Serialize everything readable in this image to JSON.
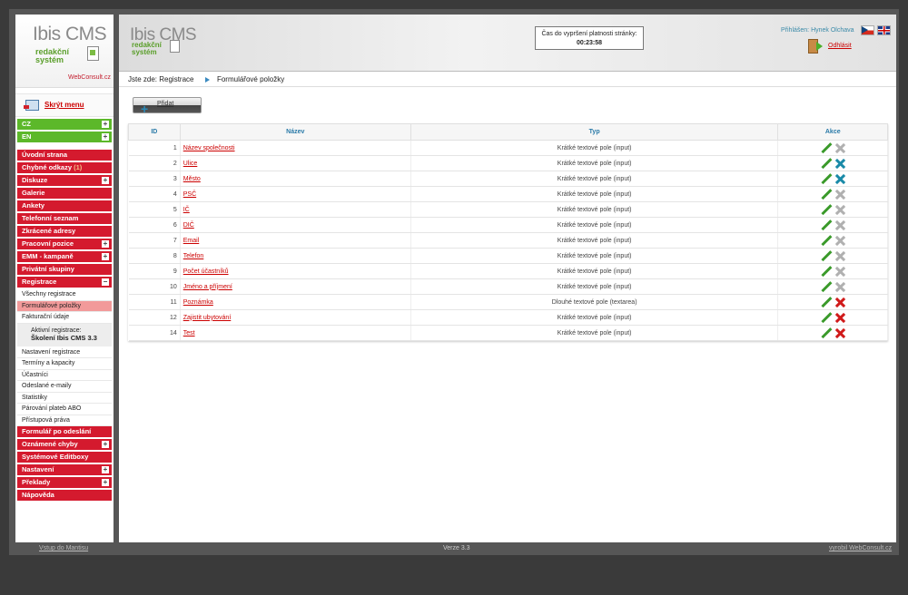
{
  "logo": {
    "title": "Ibis CMS",
    "sub1": "redakční",
    "sub2": "systém",
    "brand": "WebConsult.cz"
  },
  "sidebar": {
    "hide_menu": "Skrýt menu",
    "langs": [
      {
        "label": "CZ"
      },
      {
        "label": "EN"
      }
    ],
    "items_top": [
      {
        "label": "Úvodní strana",
        "plus": false
      },
      {
        "label": "Chybné odkazy",
        "count": "(1)",
        "plus": false
      },
      {
        "label": "Diskuze",
        "plus": true
      },
      {
        "label": "Galerie",
        "plus": false
      },
      {
        "label": "Ankety",
        "plus": false
      },
      {
        "label": "Telefonní seznam",
        "plus": false
      },
      {
        "label": "Zkrácené adresy",
        "plus": false
      },
      {
        "label": "Pracovní pozice",
        "plus": true
      },
      {
        "label": "EMM - kampaně",
        "plus": true
      },
      {
        "label": "Privátní skupiny",
        "plus": false
      },
      {
        "label": "Registrace",
        "minus": true
      }
    ],
    "reg_sub1": [
      "Všechny registrace",
      "Formulářové položky",
      "Fakturační údaje"
    ],
    "active_reg_label": "Aktivní registrace:",
    "active_reg_value": "Školení Ibis CMS 3.3",
    "reg_sub2": [
      "Nastavení registrace",
      "Termíny a kapacity",
      "Účastníci",
      "Odeslané e-maily",
      "Statistiky",
      "Párování plateb ABO",
      "Přístupová práva"
    ],
    "items_bottom": [
      {
        "label": "Formulář po odeslání",
        "plus": false
      },
      {
        "label": "Oznámené chyby",
        "plus": true
      },
      {
        "label": "Systémové Editboxy",
        "plus": false
      },
      {
        "label": "Nastavení",
        "plus": true
      },
      {
        "label": "Překlady",
        "plus": true
      },
      {
        "label": "Nápověda",
        "plus": false
      }
    ]
  },
  "header": {
    "timer_label": "Čas do vypršení platnosti stránky:",
    "timer_value": "00:23:58",
    "user": "Přihlášen: Hynek Olchava",
    "logout": "Odhlásit"
  },
  "breadcrumb": {
    "prefix": "Jste zde:",
    "item1": "Registrace",
    "item2": "Formulářové položky"
  },
  "add_button": "Přidat",
  "table": {
    "headers": {
      "id": "ID",
      "name": "Název",
      "type": "Typ",
      "actions": "Akce"
    },
    "rows": [
      {
        "id": "1",
        "name": "Název společnosti",
        "type": "Krátké textové pole (input)",
        "delete": "gray"
      },
      {
        "id": "2",
        "name": "Ulice",
        "type": "Krátké textové pole (input)",
        "delete": "teal"
      },
      {
        "id": "3",
        "name": "Město",
        "type": "Krátké textové pole (input)",
        "delete": "teal"
      },
      {
        "id": "4",
        "name": "PSČ",
        "type": "Krátké textové pole (input)",
        "delete": "gray"
      },
      {
        "id": "5",
        "name": "IČ",
        "type": "Krátké textové pole (input)",
        "delete": "gray"
      },
      {
        "id": "6",
        "name": "DIČ",
        "type": "Krátké textové pole (input)",
        "delete": "gray"
      },
      {
        "id": "7",
        "name": "Email",
        "type": "Krátké textové pole (input)",
        "delete": "gray"
      },
      {
        "id": "8",
        "name": "Telefon",
        "type": "Krátké textové pole (input)",
        "delete": "gray"
      },
      {
        "id": "9",
        "name": "Počet účastníků",
        "type": "Krátké textové pole (input)",
        "delete": "gray"
      },
      {
        "id": "10",
        "name": "Jméno a příjmení",
        "type": "Krátké textové pole (input)",
        "delete": "gray"
      },
      {
        "id": "11",
        "name": "Poznámka",
        "type": "Dlouhé textové pole (textarea)",
        "delete": "red"
      },
      {
        "id": "12",
        "name": "Zajistit ubytování",
        "type": "Krátké textové pole (input)",
        "delete": "red"
      },
      {
        "id": "14",
        "name": "Test",
        "type": "Krátké textové pole (input)",
        "delete": "red"
      }
    ]
  },
  "footer": {
    "left": "Vstup do Mantisu",
    "mid": "Verze 3.3",
    "right": "vyrobil WebConsult.cz"
  }
}
